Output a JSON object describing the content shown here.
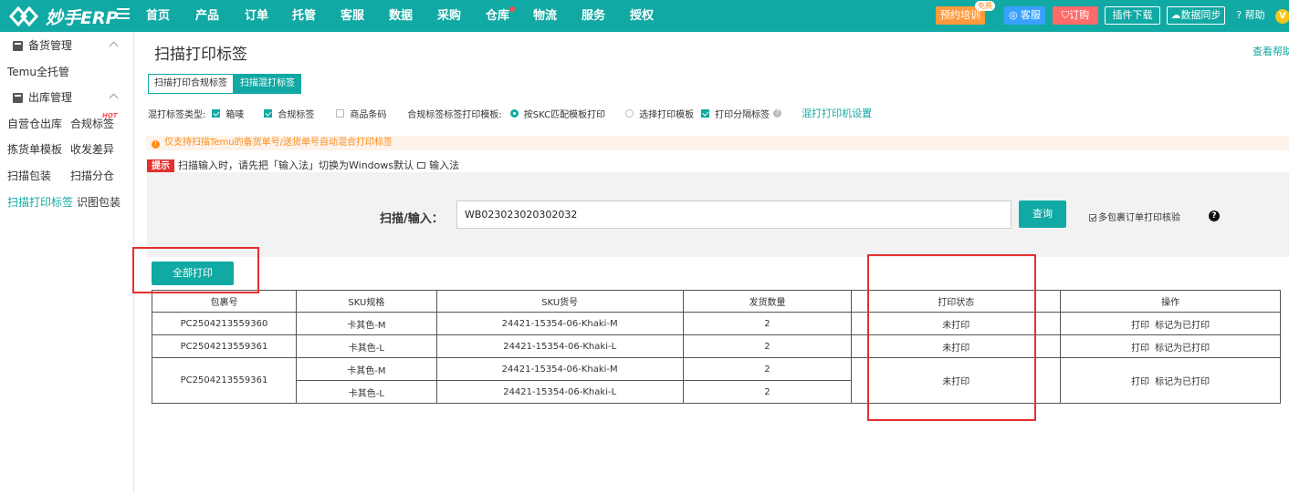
{
  "app": {
    "logo_text": "妙手ERP"
  },
  "nav": [
    "首页",
    "产品",
    "订单",
    "托管",
    "客服",
    "数据",
    "采购",
    "仓库",
    "物流",
    "服务",
    "授权"
  ],
  "topbar": {
    "training": "预约培训",
    "free_badge": "免费",
    "service": "客服",
    "order": "订购",
    "plugin": "插件下载",
    "sync": "数据同步",
    "help": "帮助",
    "vip": "V"
  },
  "sidebar": {
    "group1": "备货管理",
    "temu_full": "Temu全托管",
    "group2": "出库管理",
    "items": [
      "自营仓出库",
      "合规标签",
      "拣货单模板",
      "收发差异",
      "扫描包装",
      "扫描分仓",
      "扫描打印标签",
      "识图包装"
    ],
    "hot": "HOT"
  },
  "page": {
    "title": "扫描打印标签",
    "help_link": "查看帮助",
    "tabs": [
      "扫描打印合规标签",
      "扫描混打标签"
    ],
    "options": {
      "type_label": "混打标签类型:",
      "box": "箱唛",
      "compliance": "合规标签",
      "barcode": "商品条码",
      "template_label": "合规标签标签打印模板:",
      "skc_match": "按SKC匹配模板打印",
      "choose_template": "选择打印模板",
      "print_separator": "打印分隔标签",
      "printer_setting": "混打打印机设置"
    },
    "warning": "仅支持扫描Temu的备货单号/送货单号自动混合打印标签",
    "tip_tag": "提示",
    "tip_text_before": "扫描输入时，请先把「输入法」切换为Windows默认",
    "tip_text_after": "输入法",
    "scan_label": "扫描/输入：",
    "scan_value": "WB023023020302032",
    "query": "查询",
    "multi_check": "多包裹订单打印核验",
    "print_all": "全部打印"
  },
  "table": {
    "headers": [
      "包裹号",
      "SKU规格",
      "SKU货号",
      "发货数量",
      "打印状态",
      "操作"
    ],
    "status": "未打印",
    "op_print": "打印",
    "op_mark": "标记为已打印",
    "rows": [
      {
        "package": "PC2504213559360",
        "items": [
          {
            "spec": "卡其色-M",
            "sku": "24421-15354-06-Khaki-M",
            "qty": "2"
          }
        ]
      },
      {
        "package": "PC2504213559361",
        "items": [
          {
            "spec": "卡其色-L",
            "sku": "24421-15354-06-Khaki-L",
            "qty": "2"
          }
        ]
      },
      {
        "package": "PC2504213559361",
        "items": [
          {
            "spec": "卡其色-M",
            "sku": "24421-15354-06-Khaki-M",
            "qty": "2"
          },
          {
            "spec": "卡其色-L",
            "sku": "24421-15354-06-Khaki-L",
            "qty": "2"
          }
        ]
      }
    ]
  }
}
